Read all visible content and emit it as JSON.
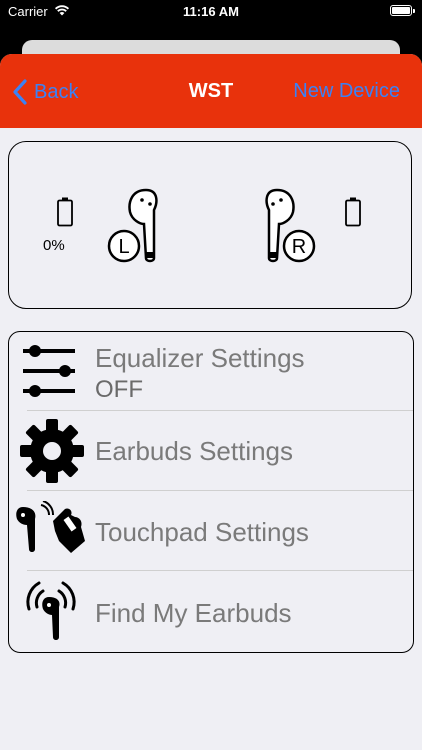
{
  "status": {
    "carrier": "Carrier",
    "time": "11:16 AM"
  },
  "nav": {
    "back_label": "Back",
    "title": "WST",
    "right_label": "New Device"
  },
  "earbuds": {
    "left_battery_percent": "0%",
    "left_label": "L",
    "right_label": "R"
  },
  "menu": {
    "equalizer": {
      "label": "Equalizer Settings",
      "value": "OFF"
    },
    "earbuds": {
      "label": "Earbuds Settings"
    },
    "touchpad": {
      "label": "Touchpad Settings"
    },
    "find": {
      "label": "Find My Earbuds"
    }
  },
  "colors": {
    "nav_bg": "#e8320c",
    "link": "#3b82f6",
    "menu_text": "#7a7a7a"
  }
}
